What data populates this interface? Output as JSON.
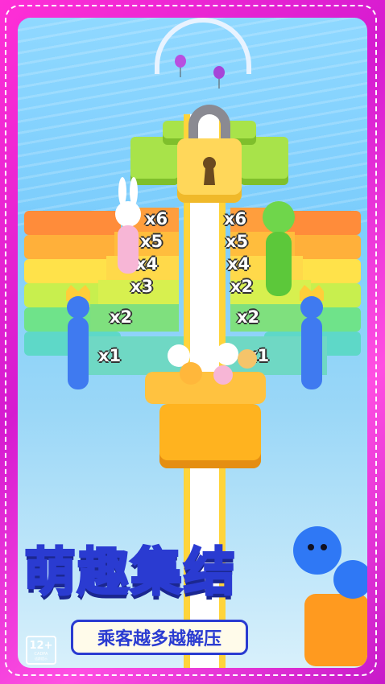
{
  "multipliers_left": [
    "x6",
    "x5",
    "x4",
    "x3",
    "x2",
    "x1"
  ],
  "multipliers_right": [
    "x6",
    "x5",
    "x4",
    "x2",
    "x2",
    "x1"
  ],
  "title": "萌趣集结",
  "subtitle": "乘客越多越解压",
  "age_rating": {
    "label": "12+",
    "org": "CADPA",
    "note": "适龄提示"
  },
  "colors": {
    "frame": "#ff2fd6",
    "title_stroke": "#2a3bd1",
    "track_rail": "#ffd43b"
  },
  "icons": [
    "padlock-icon",
    "keyhole-icon",
    "crown-icon",
    "balloon-icon"
  ]
}
